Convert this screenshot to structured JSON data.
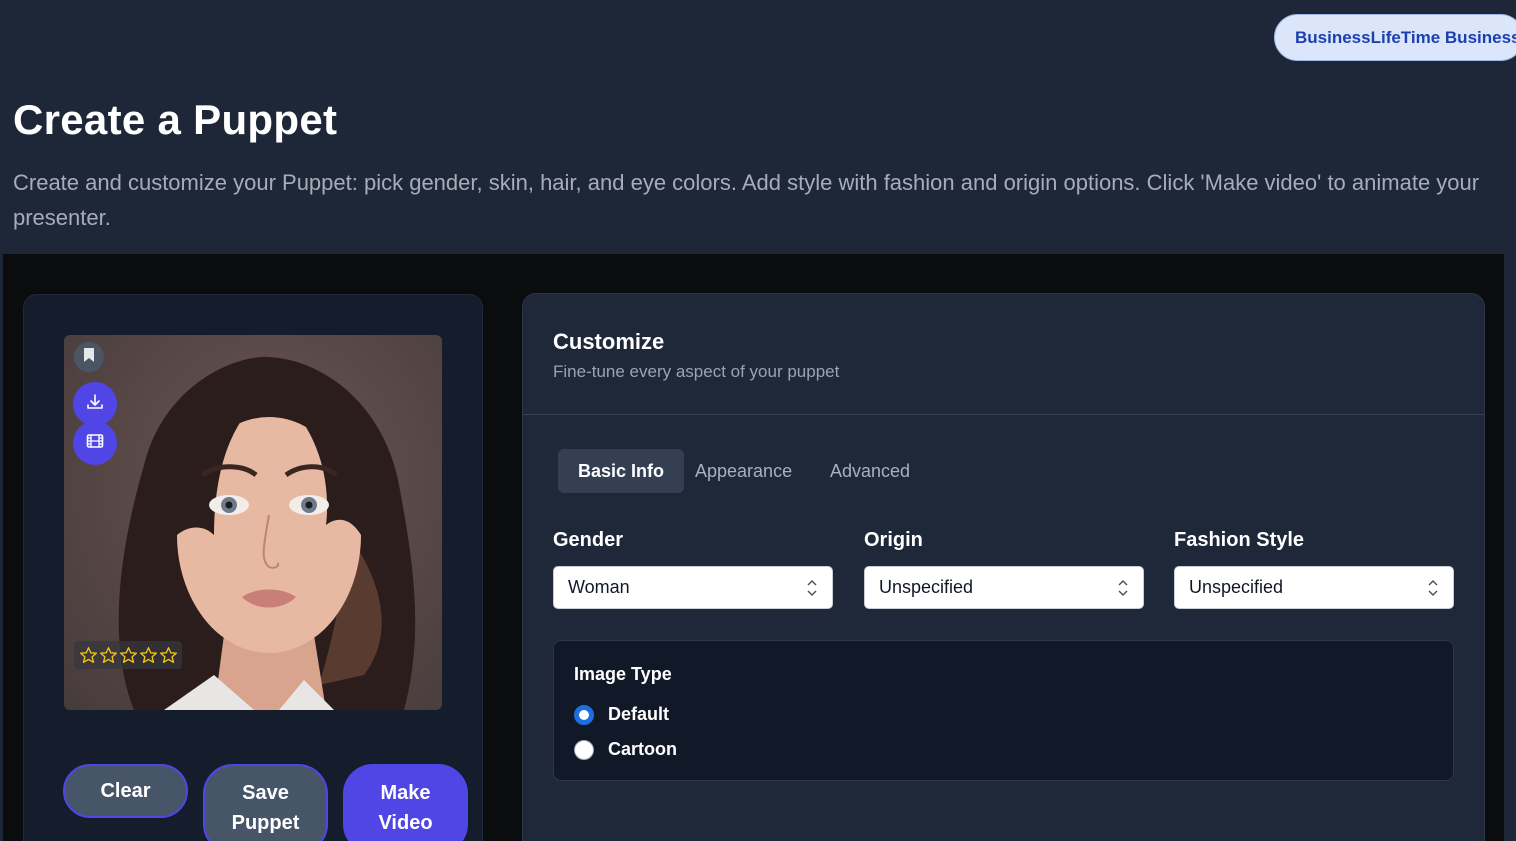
{
  "header": {
    "plan_badge": "BusinessLifeTime Business",
    "title": "Create a Puppet",
    "description": "Create and customize your Puppet: pick gender, skin, hair, and eye colors. Add style with fashion and origin options. Click 'Make video' to animate your presenter."
  },
  "preview": {
    "rating_stars": 5,
    "rating_value": 0,
    "icons": [
      "bookmark-icon",
      "download-icon",
      "film-icon",
      "star-icon"
    ],
    "actions": {
      "clear_label": "Clear",
      "save_label_line1": "Save",
      "save_label_line2": "Puppet",
      "make_label_line1": "Make",
      "make_label_line2": "Video"
    }
  },
  "customize": {
    "title": "Customize",
    "subtitle": "Fine-tune every aspect of your puppet",
    "tabs": [
      {
        "label": "Basic Info",
        "active": true
      },
      {
        "label": "Appearance",
        "active": false
      },
      {
        "label": "Advanced",
        "active": false
      }
    ],
    "fields": {
      "gender": {
        "label": "Gender",
        "value": "Woman"
      },
      "origin": {
        "label": "Origin",
        "value": "Unspecified"
      },
      "fashion": {
        "label": "Fashion Style",
        "value": "Unspecified"
      }
    },
    "image_type": {
      "title": "Image Type",
      "options": [
        {
          "label": "Default",
          "checked": true
        },
        {
          "label": "Cartoon",
          "checked": false
        }
      ]
    }
  },
  "colors": {
    "page_bg": "#1e2738",
    "accent": "#4f46e5",
    "radio_checked": "#1d6fe0",
    "star": "#f5c518"
  }
}
